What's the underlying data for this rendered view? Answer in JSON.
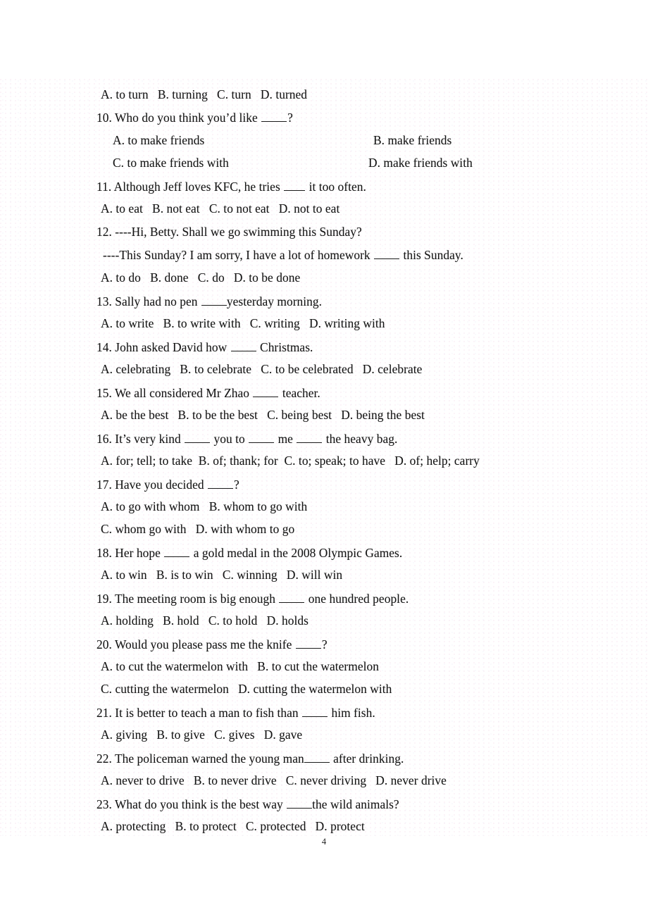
{
  "document": {
    "page_number": "4",
    "subject": "English grammar multiple-choice worksheet"
  },
  "lines": [
    {
      "id": "q9_options",
      "text": "A. to turn   B. turning   C. turn   D. turned"
    },
    {
      "id": "q10_stem_a",
      "text": "10. Who do you think you’d like "
    },
    {
      "id": "q10_stem_b",
      "text": "?"
    },
    {
      "id": "q10_option_a",
      "text": "A. to make friends"
    },
    {
      "id": "q10_option_b",
      "text": "B. make friends"
    },
    {
      "id": "q10_option_c",
      "text": "C. to make friends with"
    },
    {
      "id": "q10_option_d",
      "text": "D. make friends with"
    },
    {
      "id": "q11_stem_a",
      "text": "11. Although Jeff loves KFC, he tries "
    },
    {
      "id": "q11_stem_b",
      "text": " it too often."
    },
    {
      "id": "q11_options",
      "text": "A. to eat   B. not eat   C. to not eat   D. not to eat"
    },
    {
      "id": "q12_stem",
      "text": "12. ----Hi, Betty. Shall we go swimming this Sunday?"
    },
    {
      "id": "q12_stem2_a",
      "text": "----This Sunday? I am sorry, I have a lot of homework "
    },
    {
      "id": "q12_stem2_b",
      "text": " this Sunday."
    },
    {
      "id": "q12_options",
      "text": "A. to do   B. done   C. do   D. to be done"
    },
    {
      "id": "q13_stem_a",
      "text": "13. Sally had no pen "
    },
    {
      "id": "q13_stem_b",
      "text": "yesterday morning."
    },
    {
      "id": "q13_options",
      "text": "A. to write   B. to write with   C. writing   D. writing with"
    },
    {
      "id": "q14_stem_a",
      "text": "14. John asked David how "
    },
    {
      "id": "q14_stem_b",
      "text": " Christmas."
    },
    {
      "id": "q14_options",
      "text": "A. celebrating   B. to celebrate   C. to be celebrated   D. celebrate"
    },
    {
      "id": "q15_stem_a",
      "text": "15. We all considered Mr Zhao "
    },
    {
      "id": "q15_stem_b",
      "text": " teacher."
    },
    {
      "id": "q15_options",
      "text": "A. be the best   B. to be the best   C. being best   D. being the best"
    },
    {
      "id": "q16_stem_a",
      "text": "16. It’s very kind "
    },
    {
      "id": "q16_stem_b",
      "text": " you to "
    },
    {
      "id": "q16_stem_c",
      "text": " me "
    },
    {
      "id": "q16_stem_d",
      "text": " the heavy bag."
    },
    {
      "id": "q16_options",
      "text": "A. for; tell; to take  B. of; thank; for  C. to; speak; to have   D. of; help; carry"
    },
    {
      "id": "q17_stem_a",
      "text": "17. Have you decided "
    },
    {
      "id": "q17_stem_b",
      "text": "?"
    },
    {
      "id": "q17_options_1",
      "text": "A. to go with whom   B. whom to go with"
    },
    {
      "id": "q17_options_2",
      "text": "C. whom go with   D. with whom to go"
    },
    {
      "id": "q18_stem_a",
      "text": "18. Her hope "
    },
    {
      "id": "q18_stem_b",
      "text": " a gold medal in the 2008 Olympic Games."
    },
    {
      "id": "q18_options",
      "text": "A. to win   B. is to win   C. winning   D. will win"
    },
    {
      "id": "q19_stem_a",
      "text": "19. The meeting room is big enough "
    },
    {
      "id": "q19_stem_b",
      "text": " one hundred people."
    },
    {
      "id": "q19_options",
      "text": "A. holding   B. hold   C. to hold   D. holds"
    },
    {
      "id": "q20_stem_a",
      "text": "20. Would you please pass me the knife "
    },
    {
      "id": "q20_stem_b",
      "text": "?"
    },
    {
      "id": "q20_options_1",
      "text": "A. to cut the watermelon with   B. to cut the watermelon"
    },
    {
      "id": "q20_options_2",
      "text": "C. cutting the watermelon   D. cutting the watermelon with"
    },
    {
      "id": "q21_stem_a",
      "text": "21. It is better to teach a man to fish than "
    },
    {
      "id": "q21_stem_b",
      "text": " him fish."
    },
    {
      "id": "q21_options",
      "text": "A. giving   B. to give   C. gives   D. gave"
    },
    {
      "id": "q22_stem_a",
      "text": "22. The policeman warned the young man"
    },
    {
      "id": "q22_stem_b",
      "text": " after drinking."
    },
    {
      "id": "q22_options",
      "text": "A. never to drive   B. to never drive   C. never driving   D. never drive"
    },
    {
      "id": "q23_stem_a",
      "text": "23. What do you think is the best way "
    },
    {
      "id": "q23_stem_b",
      "text": "the wild animals?"
    },
    {
      "id": "q23_options",
      "text": "A. protecting   B. to protect   C. protected   D. protect"
    }
  ]
}
